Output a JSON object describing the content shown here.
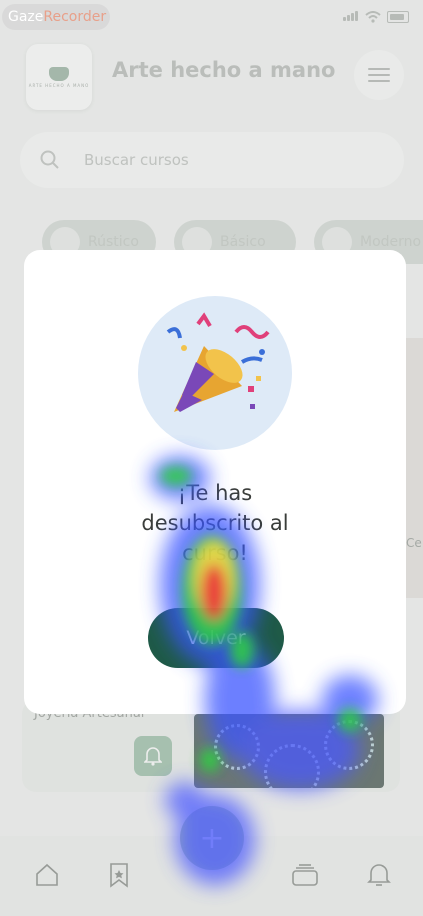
{
  "recorder": {
    "label_part1": "Gaze",
    "label_part2": "Recorder"
  },
  "header": {
    "title": "Arte hecho a mano",
    "logo_text": "ARTE HECHO A MANO"
  },
  "search": {
    "placeholder": "Buscar cursos"
  },
  "categories": [
    {
      "label": "Rústico"
    },
    {
      "label": "Básico"
    },
    {
      "label": "Moderno"
    }
  ],
  "background_card": {
    "author": "Joyería Artesanal",
    "side_text": "Ce"
  },
  "modal": {
    "message_line1": "¡Te has",
    "message_line2": "desubscrito al",
    "message_line3": "curso!",
    "button_label": "Volver"
  },
  "colors": {
    "primary": "#1f5a47",
    "accent_soft": "#a7c3b2",
    "modal_icon_bg": "#deeaf7"
  }
}
